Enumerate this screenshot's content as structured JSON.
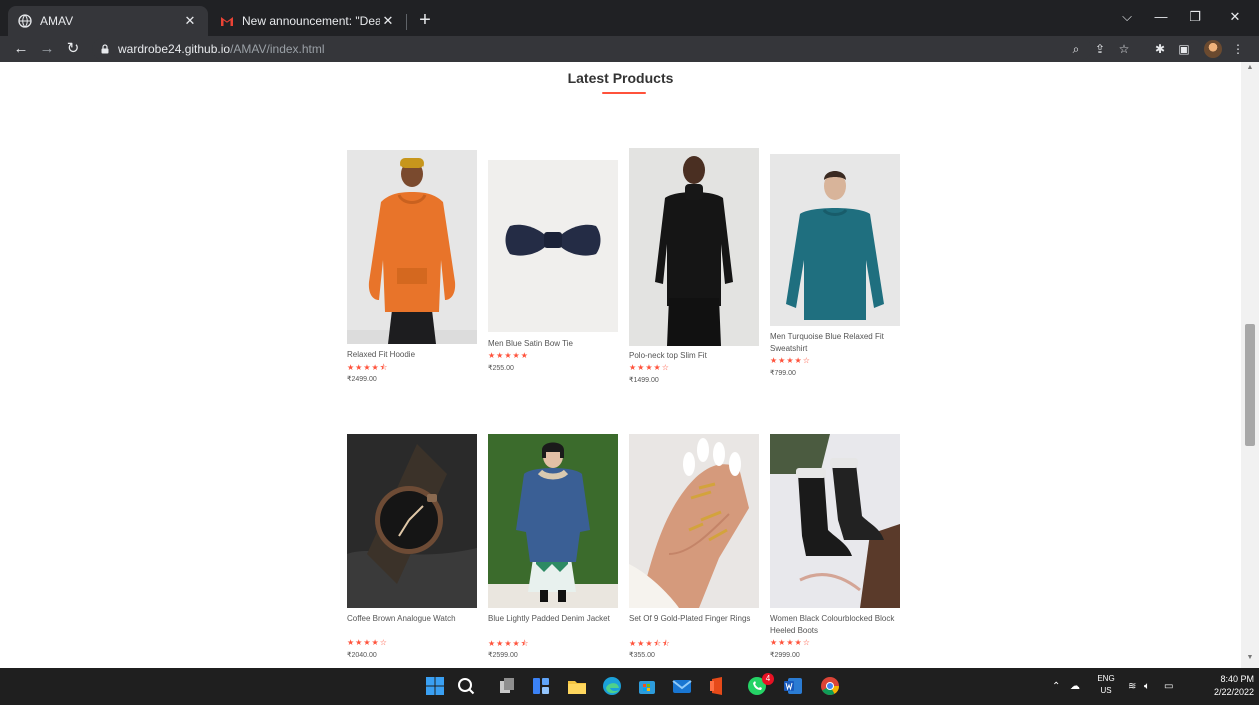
{
  "browser": {
    "tabs": [
      {
        "title": "AMAV",
        "icon": "globe-icon"
      },
      {
        "title": "New announcement: \"Dear stude",
        "icon": "gmail-icon"
      }
    ],
    "new_tab_label": "+",
    "url_host": "wardrobe24.github.io",
    "url_path": "/AMAV/index.html"
  },
  "page": {
    "section_title": "Latest Products",
    "accent_color": "#ff523b",
    "products": [
      {
        "name": "Relaxed Fit Hoodie",
        "rating_text": "★★★★⯪",
        "rating": 4.5,
        "price": "₹2499.00"
      },
      {
        "name": "Men Blue Satin Bow Tie",
        "rating_text": "★★★★★",
        "rating": 5,
        "price": "₹255.00"
      },
      {
        "name": "Polo-neck top Slim Fit",
        "rating_text": "★★★★☆",
        "rating": 4,
        "price": "₹1499.00"
      },
      {
        "name": "Men Turquoise Blue Relaxed Fit Sweatshirt",
        "rating_text": "★★★★☆",
        "rating": 4,
        "price": "₹799.00"
      },
      {
        "name": "Coffee Brown Analogue Watch",
        "rating_text": "★★★★☆",
        "rating": 4,
        "price": "₹2040.00"
      },
      {
        "name": "Blue Lightly Padded Denim Jacket",
        "rating_text": "★★★★⯪",
        "rating": 4.5,
        "price": "₹2599.00"
      },
      {
        "name": "Set Of 9 Gold-Plated Finger Rings",
        "rating_text": "★★★⯪⯪",
        "rating": 3.5,
        "price": "₹355.00"
      },
      {
        "name": "Women Black Colourblocked Block Heeled Boots",
        "rating_text": "★★★★☆",
        "rating": 4,
        "price": "₹2999.00"
      }
    ]
  },
  "taskbar": {
    "language": "ENG",
    "region": "US",
    "time": "8:40 PM",
    "date": "2/22/2022",
    "whatsapp_badge": "4"
  }
}
